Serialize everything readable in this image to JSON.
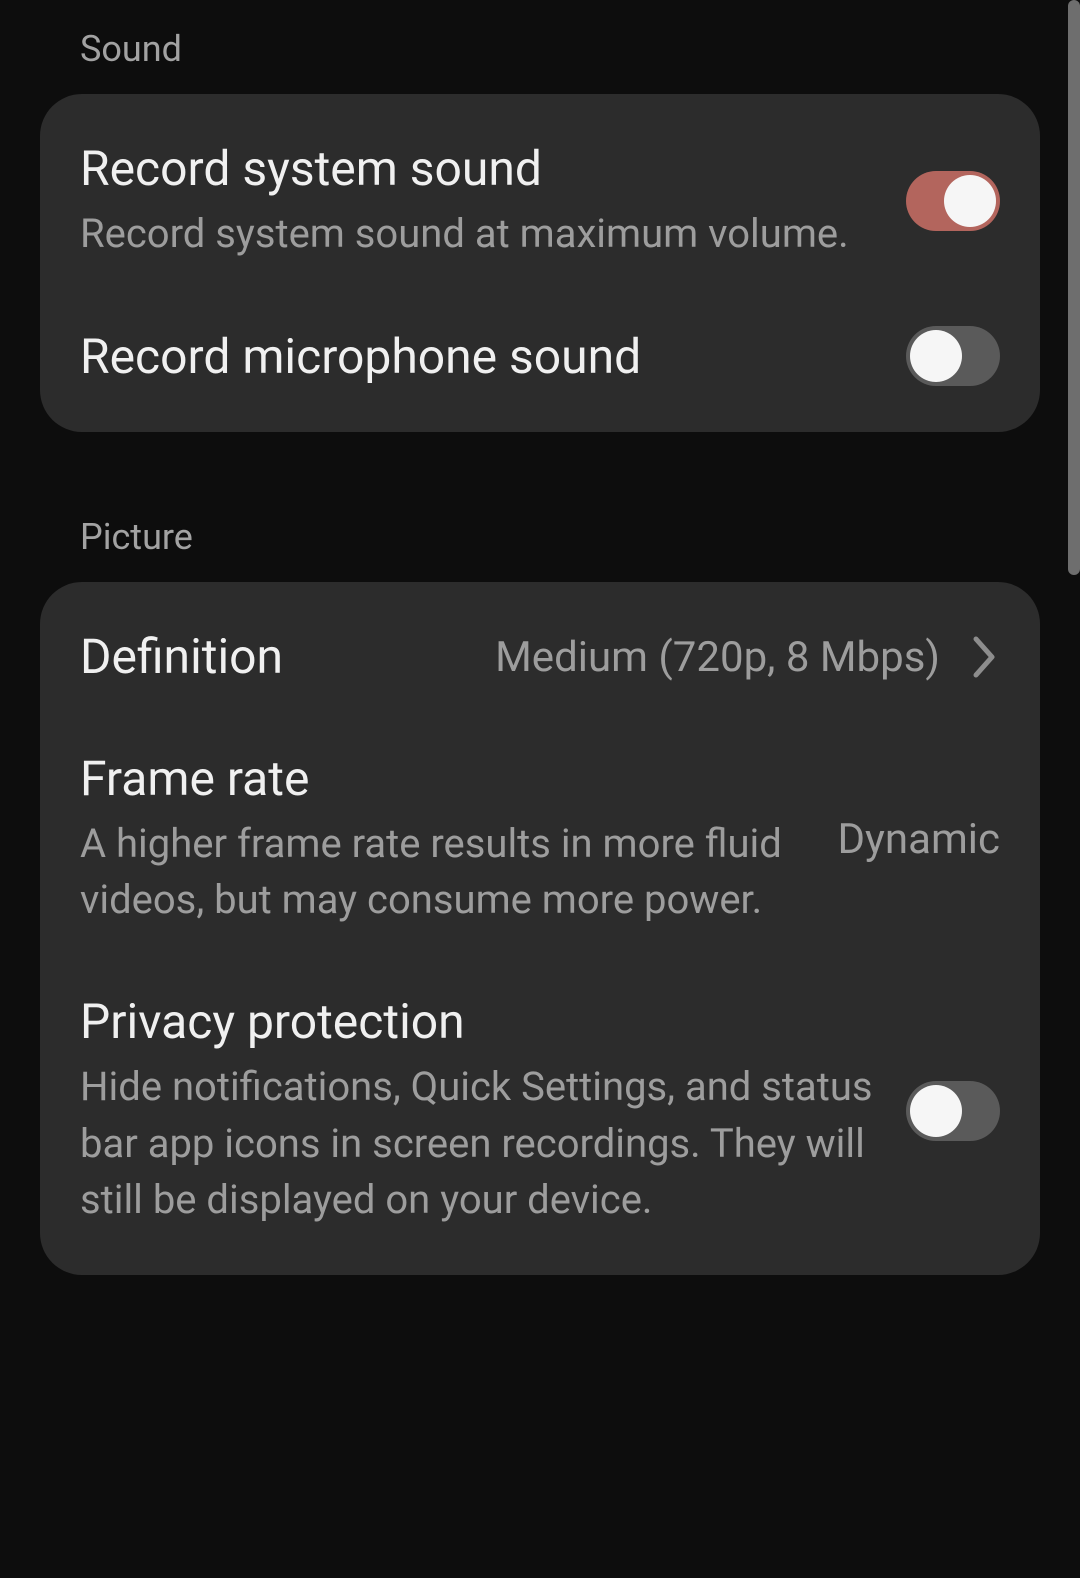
{
  "sections": {
    "sound": {
      "header": "Sound",
      "items": [
        {
          "title": "Record system sound",
          "sub": "Record system sound at maximum volume.",
          "toggle": true
        },
        {
          "title": "Record microphone sound",
          "toggle": false
        }
      ]
    },
    "picture": {
      "header": "Picture",
      "items": [
        {
          "title": "Definition",
          "value": "Medium (720p, 8 Mbps)"
        },
        {
          "title": "Frame rate",
          "sub": "A higher frame rate results in more fluid videos, but may consume more power.",
          "value": "Dynamic"
        },
        {
          "title": "Privacy protection",
          "sub": "Hide notifications, Quick Settings, and status bar app icons in screen recordings. They will still be displayed on your device.",
          "toggle": false
        }
      ]
    }
  },
  "colors": {
    "toggle_on": "#b3655d",
    "toggle_off": "#5a5a5a",
    "card_bg": "#2c2c2c",
    "page_bg": "#0d0d0d"
  }
}
